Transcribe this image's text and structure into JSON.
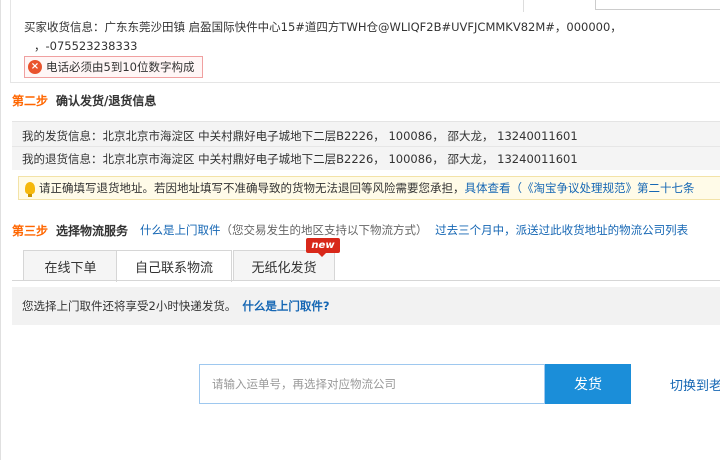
{
  "buyer": {
    "label": "买家收货信息：",
    "line1": "广东东莞沙田镇 启盈国际快件中心15#道四方TWH仓@WLIQF2B#UVFJCMMKV82M#，000000，",
    "line2": "，-075523238333"
  },
  "error": {
    "icon": "close-circle-icon",
    "text": "电话必须由5到10位数字构成"
  },
  "step2": {
    "num": "第二步",
    "title": "确认发货/退货信息",
    "ship_from": "我的发货信息：北京北京市海淀区 中关村鼎好电子城地下二层B2226， 100086， 邵大龙，   13240011601",
    "return_to": "我的退货信息：北京北京市海淀区 中关村鼎好电子城地下二层B2226， 100086， 邵大龙，   13240011601",
    "warning_text": "请正确填写退货地址。若因地址填写不准确导致的货物无法退回等风险需要您承担，",
    "warning_link1": "具体查看（",
    "warning_link2": "《淘宝争议处理规范》第二十七条"
  },
  "step3": {
    "num": "第三步",
    "title": "选择物流服务",
    "help_link": "什么是上门取件",
    "help_desc": "（您交易发生的地区支持以下物流方式）",
    "history_link": "过去三个月中，派送过此收货地址的物流公司列表"
  },
  "tabs": [
    {
      "label": "在线下单"
    },
    {
      "label": "自己联系物流"
    },
    {
      "label": "无纸化发货",
      "badge": "new"
    }
  ],
  "info_bar": {
    "text": "您选择上门取件还将享受2小时快递发货。",
    "link": "什么是上门取件?"
  },
  "tracking": {
    "placeholder": "请输入运单号，再选择对应物流公司",
    "ship_button": "发货",
    "switch_link": "切换到老"
  },
  "colors": {
    "step_orange": "#ff6600",
    "link_blue": "#1667b4",
    "button_blue": "#1b8ed9",
    "badge_red": "#d8281a"
  }
}
